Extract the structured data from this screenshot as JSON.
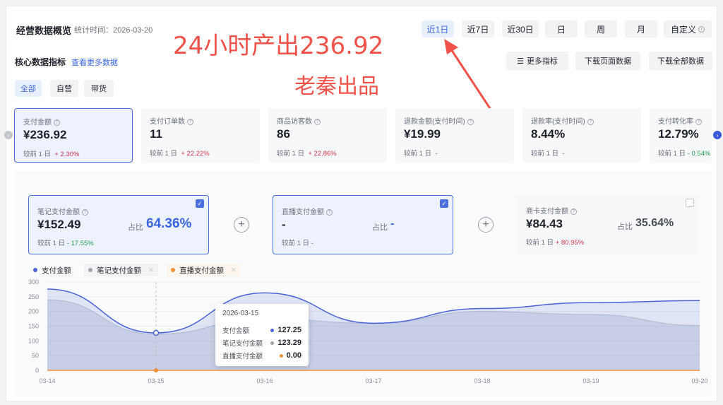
{
  "header": {
    "title": "经营数据概览",
    "stat_time": "统计时间：2026-03-20",
    "date_buttons": [
      "近1日",
      "近7日",
      "近30日",
      "日",
      "周",
      "月",
      "自定义"
    ],
    "active_date": "近1日"
  },
  "overlay": {
    "headline": "24小时产出236.92",
    "subline": "老秦出品"
  },
  "section": {
    "label": "核心数据指标",
    "more_link": "查看更多数据",
    "tools": [
      "更多指标",
      "下载页面数据",
      "下载全部数据"
    ]
  },
  "filters": [
    "全部",
    "自营",
    "带货"
  ],
  "cards": [
    {
      "label": "支付金额",
      "value": "¥236.92",
      "compare_label": "较前 1 日",
      "compare": "+ 2.30%",
      "trend": "up"
    },
    {
      "label": "支付订单数",
      "value": "11",
      "compare_label": "较前 1 日",
      "compare": "+ 22.22%",
      "trend": "up"
    },
    {
      "label": "商品访客数",
      "value": "86",
      "compare_label": "较前 1 日",
      "compare": "+ 22.86%",
      "trend": "up"
    },
    {
      "label": "退款金额(支付时间)",
      "value": "¥19.99",
      "compare_label": "较前 1 日",
      "compare": "-",
      "trend": "flat"
    },
    {
      "label": "退款率(支付时间)",
      "value": "8.44%",
      "compare_label": "较前 1 日",
      "compare": "-",
      "trend": "flat"
    },
    {
      "label": "支付转化率",
      "value": "12.79%",
      "compare_label": "较前 1 日",
      "compare": "- 0.54%",
      "trend": "down"
    }
  ],
  "breakdown": [
    {
      "label": "笔记支付金额",
      "value": "¥152.49",
      "compare_label": "较前 1 日",
      "compare": "- 17.55%",
      "trend": "down",
      "ratio_label": "占比",
      "ratio": "64.36%",
      "checked": true
    },
    {
      "label": "直播支付金额",
      "value": "-",
      "compare_label": "较前 1 日",
      "compare": "-",
      "trend": "flat",
      "ratio_label": "占比",
      "ratio": "-",
      "checked": true
    },
    {
      "label": "商卡支付金额",
      "value": "¥84.43",
      "compare_label": "较前 1 日",
      "compare": "+ 80.95%",
      "trend": "up",
      "ratio_label": "占比",
      "ratio": "35.64%",
      "checked": false
    }
  ],
  "legend": [
    {
      "name": "支付金额",
      "color": "#4a63d8",
      "closable": false
    },
    {
      "name": "笔记支付金额",
      "color": "#9ea3ab",
      "closable": true
    },
    {
      "name": "直播支付金额",
      "color": "#f0923a",
      "closable": true
    }
  ],
  "tooltip": {
    "date": "2026-03-15",
    "rows": [
      {
        "name": "支付金额",
        "value": "127.25",
        "color": "#4a63d8"
      },
      {
        "name": "笔记支付金额",
        "value": "123.29",
        "color": "#9ea3ab"
      },
      {
        "name": "直播支付金额",
        "value": "0.00",
        "color": "#f0923a"
      }
    ]
  },
  "chart_data": {
    "type": "area",
    "categories": [
      "03-14",
      "03-15",
      "03-16",
      "03-17",
      "03-18",
      "03-19",
      "03-20"
    ],
    "series": [
      {
        "name": "支付金额",
        "values": [
          276,
          127.25,
          263,
          160,
          210,
          230,
          236.92
        ]
      },
      {
        "name": "笔记支付金额",
        "values": [
          240,
          123.29,
          175,
          160,
          200,
          190,
          152.49
        ]
      },
      {
        "name": "直播支付金额",
        "values": [
          0,
          0,
          0,
          0,
          0,
          0,
          0
        ]
      }
    ],
    "ylim": [
      0,
      300
    ],
    "yticks": [
      0,
      50,
      100,
      150,
      200,
      250,
      300
    ],
    "grid": true,
    "legend_position": "top-left"
  }
}
